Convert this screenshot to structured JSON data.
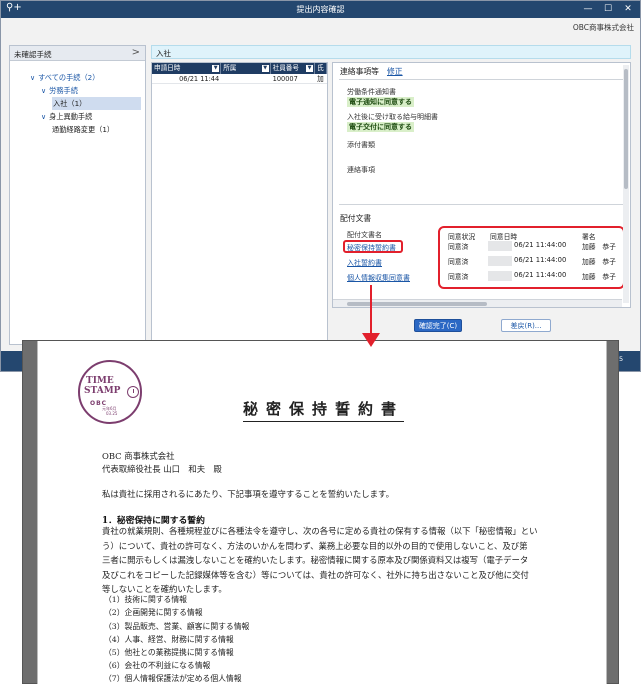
{
  "window": {
    "title": "提出内容確認",
    "app_icon": "person-add-icon",
    "company": "OBC商事株式会社"
  },
  "left_panel": {
    "header": "未確認手続",
    "chevron": ">",
    "tree": [
      {
        "label": "すべての手続（2）",
        "toggle": "∨"
      },
      {
        "label": "労務手続",
        "toggle": "∨"
      },
      {
        "label": "入社（1）"
      },
      {
        "label": "身上異動手続",
        "toggle": "∨"
      },
      {
        "label": "通勤経路変更（1）"
      }
    ]
  },
  "ribbon": {
    "label": "入社"
  },
  "grid": {
    "columns": [
      "申請日時",
      "所属",
      "社員番号",
      "氏"
    ],
    "rows": [
      {
        "date": "06/21 11:44",
        "dept": "",
        "id": "100007",
        "name": "加"
      }
    ]
  },
  "detail": {
    "contact_section": "連絡事項等",
    "edit_link": "修正",
    "fields": [
      {
        "label": "労働条件通知書",
        "badge": "電子通知に同意する"
      },
      {
        "label": "入社後に受け取る給与明細書",
        "badge": "電子交付に同意する"
      },
      {
        "label": "添付書類"
      },
      {
        "label": "連絡事項"
      }
    ],
    "docs_section": "配付文書",
    "docs_header": "配付文書名",
    "documents": [
      "秘密保持誓約書",
      "入社誓約書",
      "個人情報収集同意書"
    ],
    "agreement": {
      "headers": {
        "status": "同意状況",
        "datetime": "同意日時",
        "signer": "署名"
      },
      "rows": [
        {
          "status": "同意済",
          "datetime": "06/21 11:44:00",
          "signer": "加藤　恭子"
        },
        {
          "status": "同意済",
          "datetime": "06/21 11:44:00",
          "signer": "加藤　恭子"
        },
        {
          "status": "同意済",
          "datetime": "06/21 11:44:00",
          "signer": "加藤　恭子"
        }
      ]
    }
  },
  "buttons": {
    "confirm": "確認完了(C)",
    "return": "差戻(R)..."
  },
  "status_right": "5",
  "preview": {
    "stamp": {
      "line1": "TIME",
      "line2": "STAMP",
      "brand": "OBC",
      "date1": "元年6月",
      "date2": "03.25"
    },
    "title": "秘密保持誓約書",
    "addressee_company": "OBC 商事株式会社",
    "addressee_person": "代表取締役社長 山口　和夫　殿",
    "intro": "私は貴社に採用されるにあたり、下記事項を遵守することを誓約いたします。",
    "heading": "1．秘密保持に関する誓約",
    "paragraph_lines": [
      "貴社の就業規則、各種規程並びに各種法令を遵守し、次の各号に定める貴社の保有する情報（以下「秘密情報」とい",
      "う）について、貴社の許可なく、方法のいかんを問わず、業務上必要な目的以外の目的で使用しないこと、及び第",
      "三者に開示もしくは漏洩しないことを確約いたします。秘密情報に関する原本及び関係資料又は複写（電子データ",
      "及びこれをコピーした記録媒体等を含む）等については、貴社の許可なく、社外に持ち出さないこと及び他に交付",
      "等しないことを確約いたします。"
    ],
    "items": [
      "（1）技術に関する情報",
      "（2）企画開発に関する情報",
      "（3）製品販売、営業、顧客に関する情報",
      "（4）人事、経営、財務に関する情報",
      "（5）他社との業務提携に関する情報",
      "（6）会社の不利益になる情報",
      "（7）個人情報保護法が定める個人情報"
    ]
  },
  "colors": {
    "titlebar": "#24476f",
    "grid_header": "#1f3c63",
    "highlight": "#e2202c",
    "link": "#1a56a6",
    "stamp": "#7c3d6e"
  }
}
